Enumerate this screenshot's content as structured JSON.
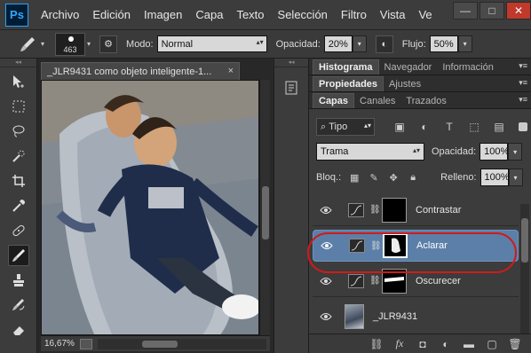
{
  "app": {
    "logo": "Ps"
  },
  "menu": [
    "Archivo",
    "Edición",
    "Imagen",
    "Capa",
    "Texto",
    "Selección",
    "Filtro",
    "Vista",
    "Ve"
  ],
  "window_controls": {
    "minimize": "—",
    "maximize": "□",
    "close": "✕"
  },
  "options": {
    "brush_size": "463",
    "mode_label": "Modo:",
    "mode_value": "Normal",
    "opacity_label": "Opacidad:",
    "opacity_value": "20%",
    "flow_label": "Flujo:",
    "flow_value": "50%"
  },
  "document": {
    "tab_title": "_JLR9431 como objeto inteligente-1...",
    "close": "×",
    "zoom": "16,67%"
  },
  "panels": {
    "row1_tabs": [
      "Histograma",
      "Navegador",
      "Información"
    ],
    "row2_tabs": [
      "Propiedades",
      "Ajustes"
    ],
    "row3_tabs": [
      "Capas",
      "Canales",
      "Trazados"
    ],
    "filter_label": "Tipo",
    "blend_mode": "Trama",
    "opacity_label": "Opacidad:",
    "opacity_value": "100%",
    "lock_label": "Bloq.:",
    "fill_label": "Relleno:",
    "fill_value": "100%"
  },
  "layers": [
    {
      "name": "Contrastar",
      "type": "adjustment",
      "selected": false
    },
    {
      "name": "Aclarar",
      "type": "adjustment",
      "selected": true
    },
    {
      "name": "Oscurecer",
      "type": "adjustment",
      "selected": false
    },
    {
      "name": "_JLR9431",
      "type": "photo",
      "selected": false
    }
  ],
  "colors": {
    "selected_layer": "#5b7fa8",
    "highlight_ring": "#d11a1a",
    "ps_blue": "#31a8ff"
  }
}
